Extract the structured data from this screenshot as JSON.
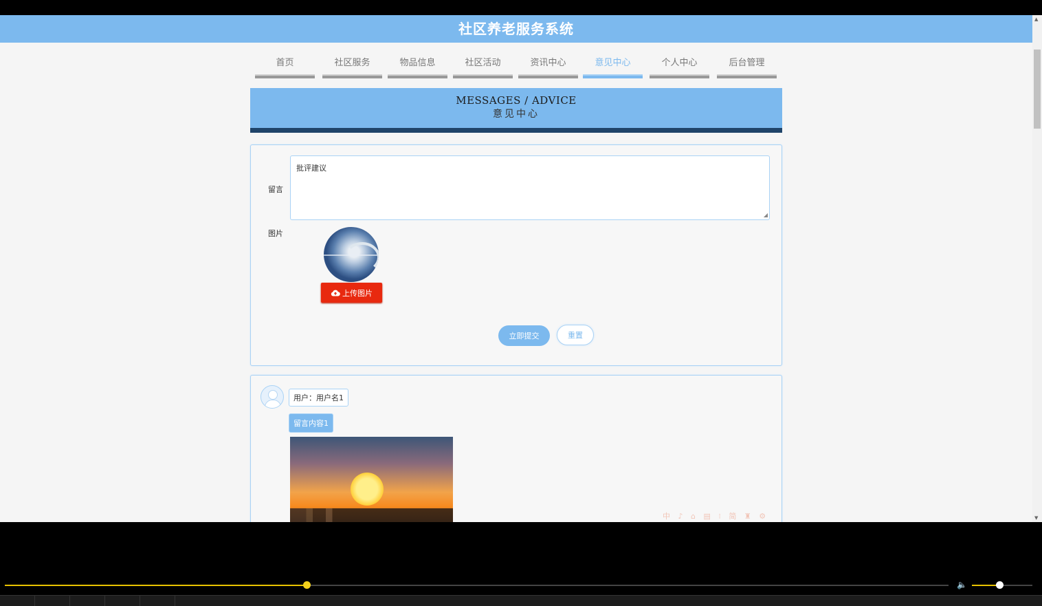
{
  "header": {
    "title": "社区养老服务系统"
  },
  "nav": {
    "items": [
      {
        "label": "首页"
      },
      {
        "label": "社区服务"
      },
      {
        "label": "物品信息"
      },
      {
        "label": "社区活动"
      },
      {
        "label": "资讯中心"
      },
      {
        "label": "意见中心",
        "active": true
      },
      {
        "label": "个人中心"
      },
      {
        "label": "后台管理"
      }
    ]
  },
  "banner": {
    "en": "MESSAGES / ADVICE",
    "cn": "意见中心"
  },
  "form": {
    "message_label": "留言",
    "message_value": "批评建议",
    "image_label": "图片",
    "upload_label": "上传图片",
    "submit_label": "立即提交",
    "reset_label": "重置"
  },
  "message": {
    "user": "用户：用户名1",
    "content": "留言内容1"
  },
  "ime": {
    "text": "中 ♪ ⌂ ▤ ⁝ 简 ♜ ⚙"
  },
  "player": {
    "progress": 0.32,
    "volume": 0.45
  },
  "colors": {
    "accent": "#7cb9ee",
    "banner_border": "#1f4469",
    "upload": "#e8290f",
    "seek": "#e8c200"
  }
}
